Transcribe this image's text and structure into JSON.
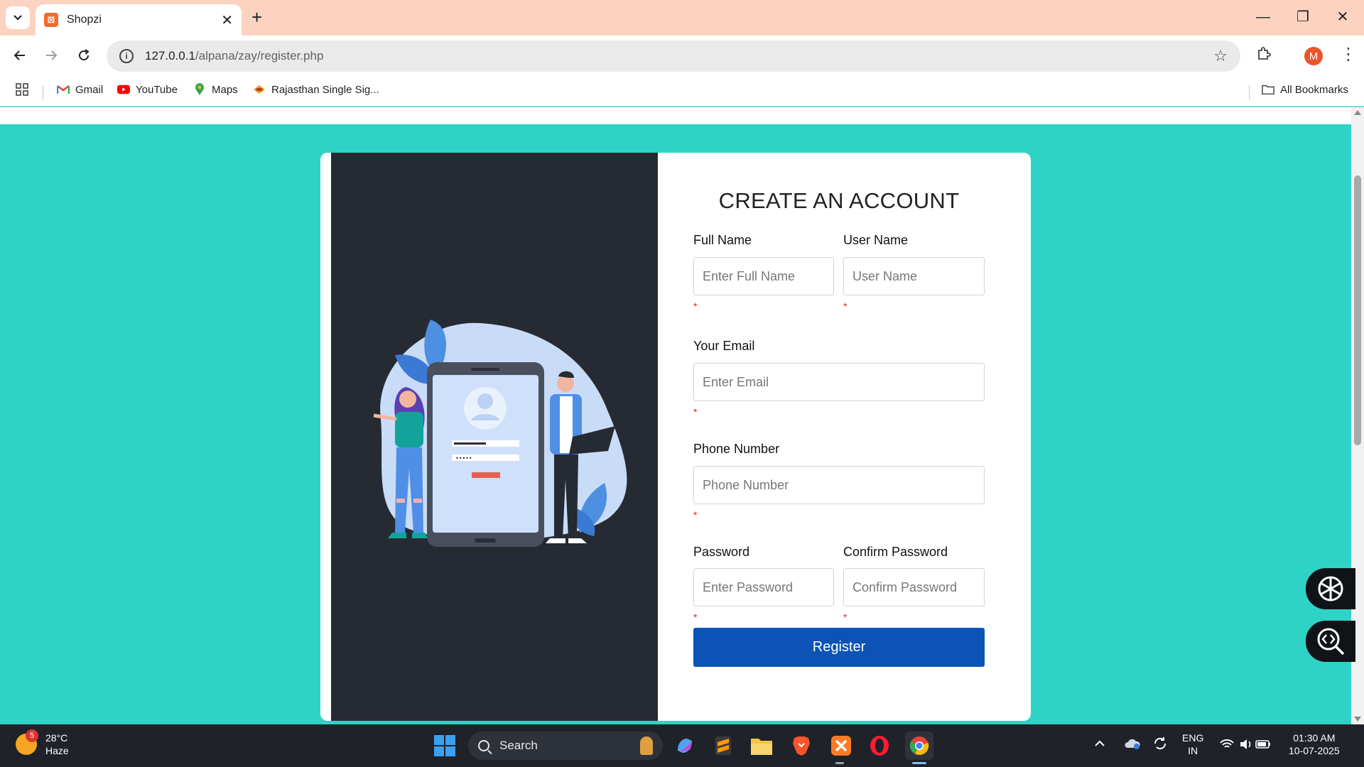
{
  "browser": {
    "tab_title": "Shopzi",
    "tab_close": "✕",
    "new_tab": "+",
    "window_controls": {
      "minimize": "—",
      "maximize": "❐",
      "close": "✕"
    },
    "url_host": "127.0.0.1",
    "url_path": "/alpana/zay/register.php",
    "profile_initial": "M",
    "bookmarks": [
      {
        "label": "Gmail",
        "icon": "gmail-icon"
      },
      {
        "label": "YouTube",
        "icon": "youtube-icon"
      },
      {
        "label": "Maps",
        "icon": "maps-icon"
      },
      {
        "label": "Rajasthan Single Sig...",
        "icon": "rajasthan-icon"
      }
    ],
    "all_bookmarks": "All Bookmarks"
  },
  "form": {
    "heading": "CREATE AN ACCOUNT",
    "full_name_label": "Full Name",
    "full_name_placeholder": "Enter Full Name",
    "user_name_label": "User Name",
    "user_name_placeholder": "User Name",
    "email_label": "Your Email",
    "email_placeholder": "Enter Email",
    "phone_label": "Phone Number",
    "phone_placeholder": "Phone Number",
    "password_label": "Password",
    "password_placeholder": "Enter Password",
    "confirm_label": "Confirm Password",
    "confirm_placeholder": "Confirm Password",
    "required_mark": "*",
    "register_label": "Register"
  },
  "taskbar": {
    "weather_temp": "28°C",
    "weather_desc": "Haze",
    "weather_badge": "5",
    "search_label": "Search",
    "lang_top": "ENG",
    "lang_bottom": "IN",
    "time": "01:30 AM",
    "date": "10-07-2025"
  },
  "colors": {
    "page_bg": "#2fd3c6",
    "left_panel": "#262a33",
    "register_button": "#0b53b4",
    "tabstrip": "#fbd3c0"
  }
}
